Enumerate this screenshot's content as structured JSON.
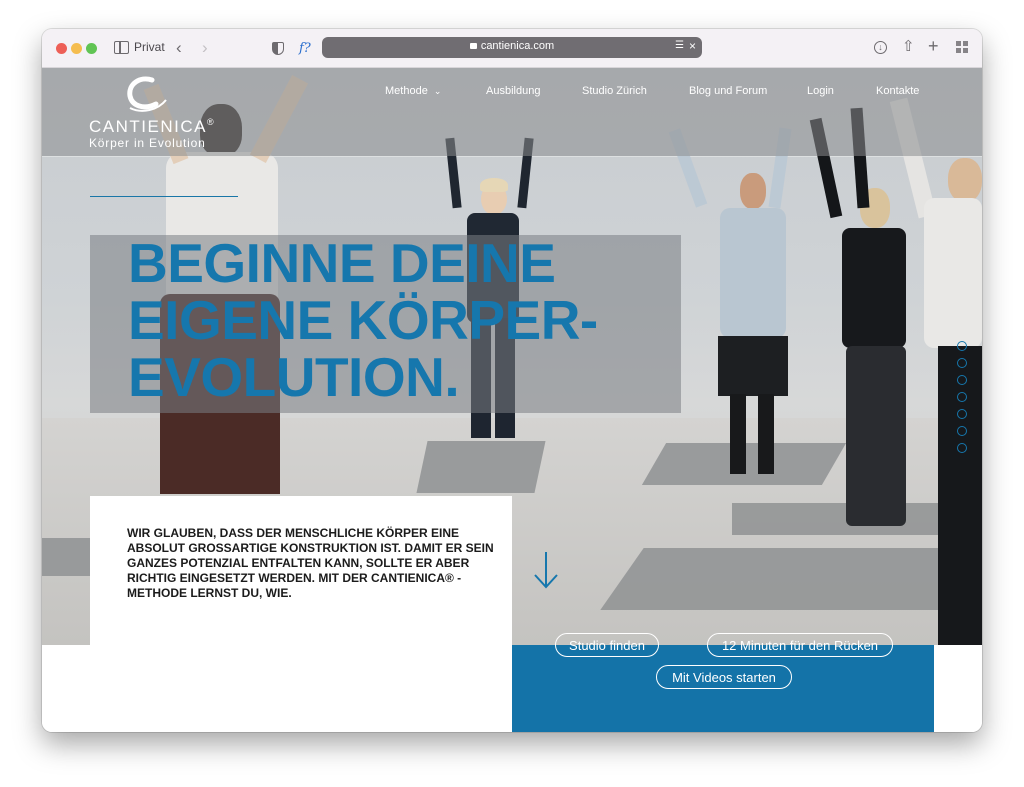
{
  "browser": {
    "mode_label": "Privat",
    "url": "cantienica.com"
  },
  "site": {
    "logo": {
      "name": "CANTIENICA",
      "registered": "®",
      "tagline": "Körper in Evolution"
    },
    "nav": [
      {
        "label": "Methode"
      },
      {
        "label": "Ausbildung"
      },
      {
        "label": "Studio Zürich"
      },
      {
        "label": "Blog und Forum"
      },
      {
        "label": "Login"
      },
      {
        "label": "Kontakte"
      }
    ],
    "headline": {
      "line1": "BEGINNE DEINE",
      "line2": "EIGENE KÖRPER-",
      "line3": "EVOLUTION."
    },
    "intro_text": "WIR GLAUBEN, DASS DER MENSCHLICHE KÖRPER EINE ABSOLUT GROSSARTIGE KONSTRUKTION IST. DAMIT ER SEIN GANZES POTENZIAL ENTFALTEN KANN, SOLLTE ER ABER RICHTIG EINGESETZT WERDEN. MIT DER CANTIENICA® - METHODE LERNST DU, WIE.",
    "slider_dot_count": 7,
    "buttons": {
      "studio": "Studio finden",
      "back": "12 Minuten für den Rücken",
      "videos": "Mit Videos starten"
    }
  },
  "colors": {
    "brand_blue": "#1677ad",
    "cta_band": "#1473a8"
  }
}
